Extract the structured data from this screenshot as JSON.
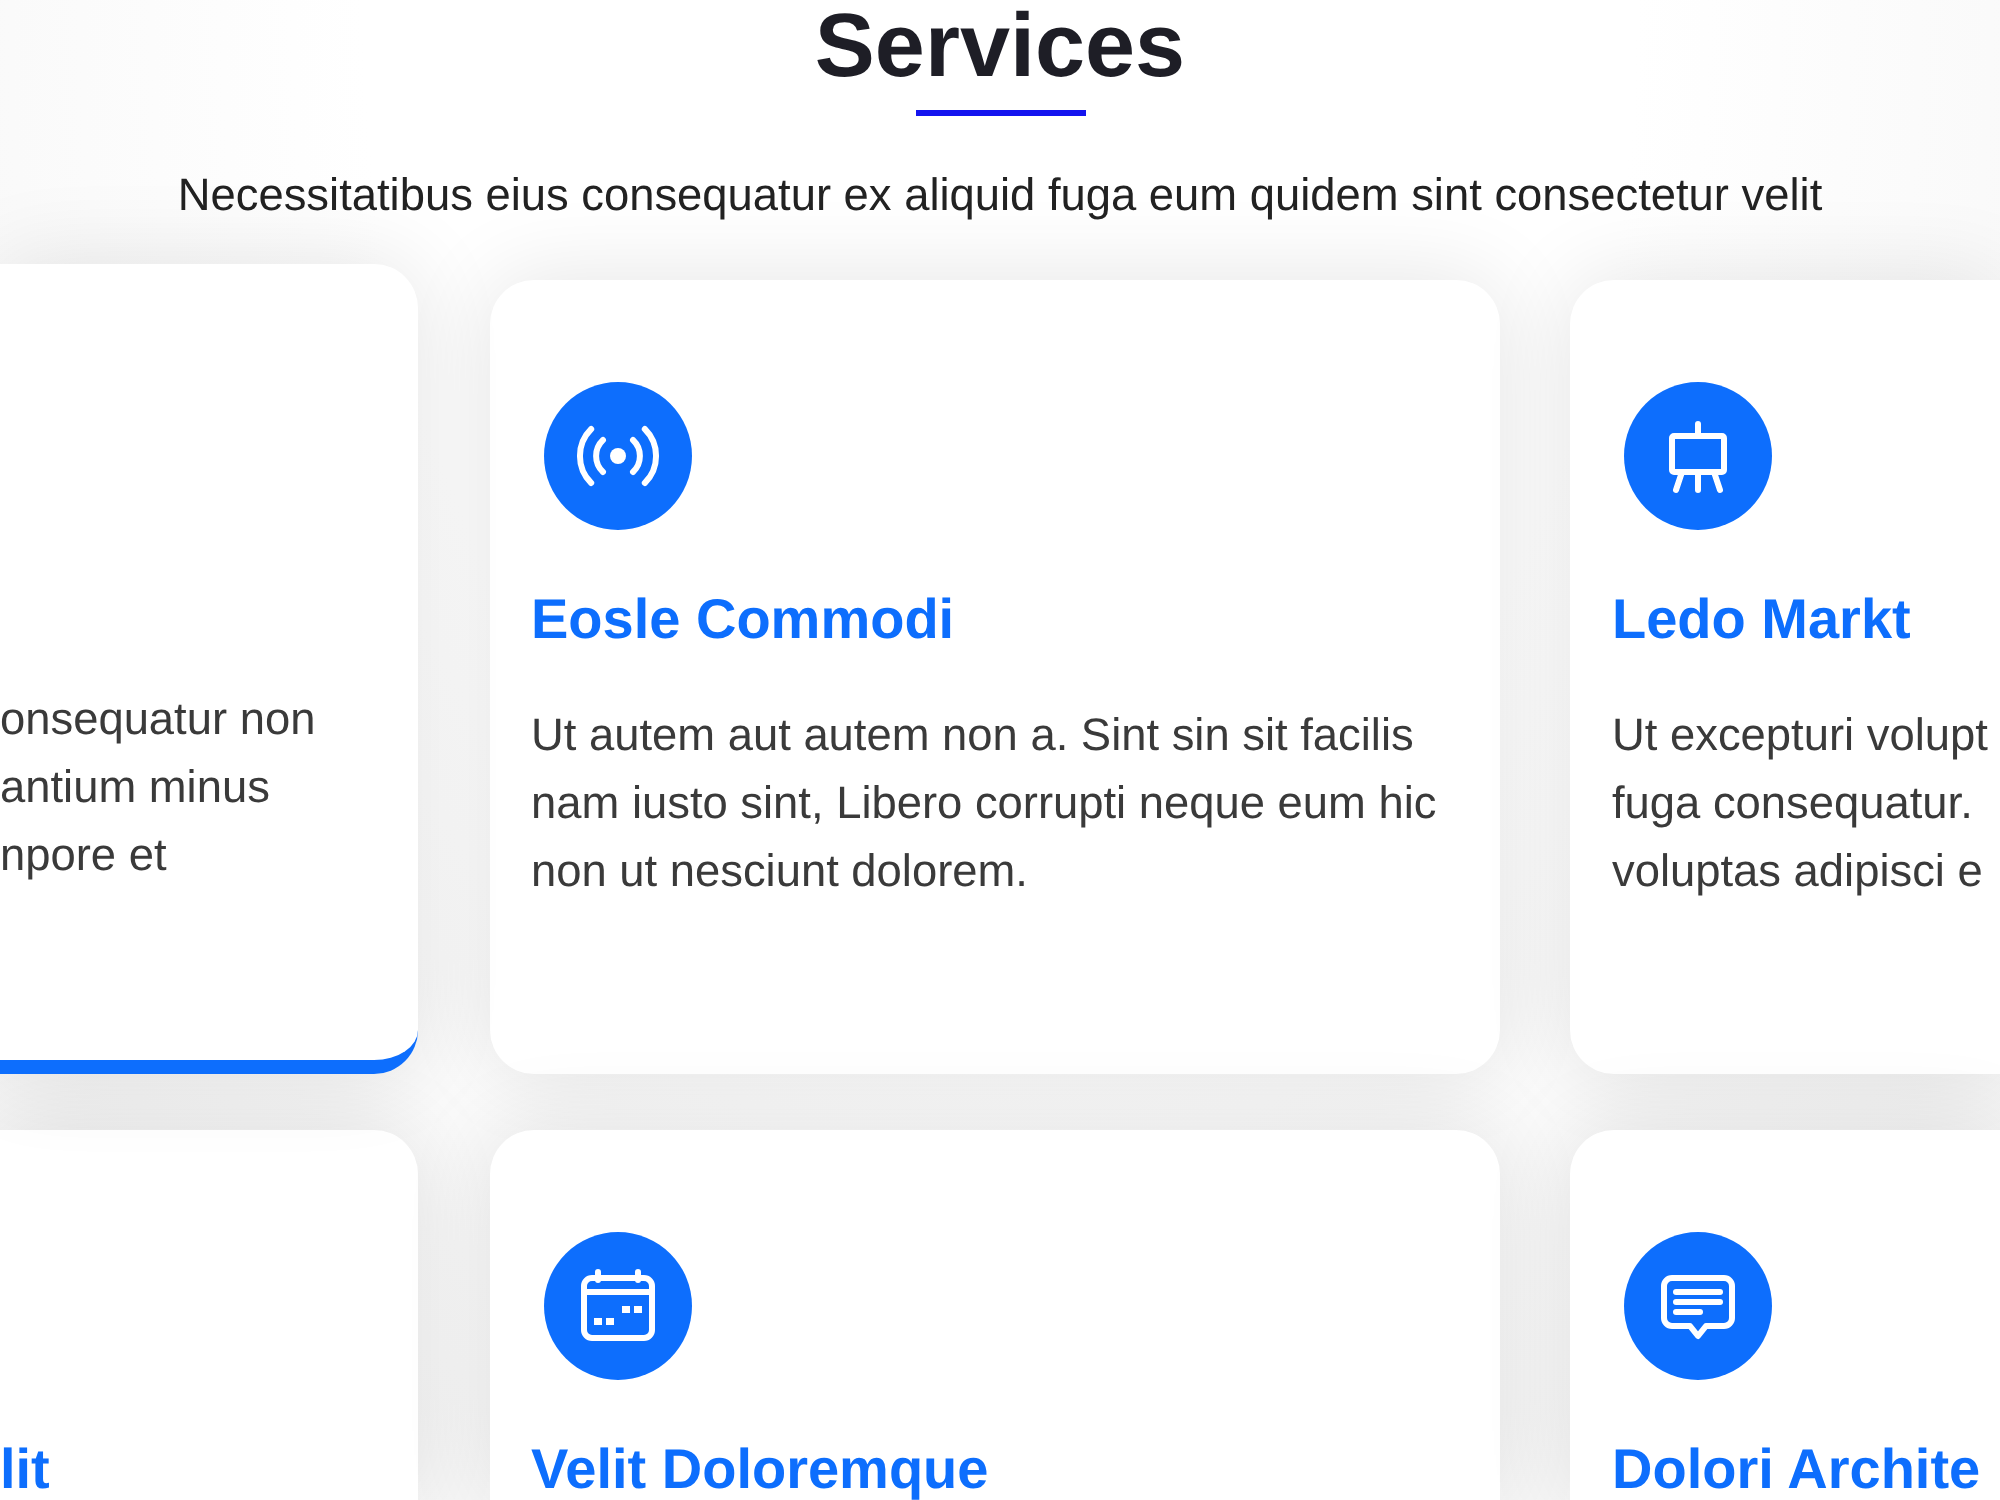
{
  "heading": {
    "title": "Services",
    "subtitle": "Necessitatibus eius consequatur ex aliquid fuga eum quidem sint consectetur velit"
  },
  "service_rows": [
    {
      "cards": [
        {
          "kind": "cut_left",
          "hovered": true,
          "description": "onsequatur non\nantium minus\nnpore et"
        },
        {
          "kind": "full",
          "hovered": false,
          "title": "Eosle Commodi",
          "description": "Ut autem aut autem non a. Sint sin sit facilis nam iusto sint, Libero corrupti neque eum hic non ut nesciunt dolorem."
        },
        {
          "kind": "cut_right",
          "hovered": false,
          "title": "Ledo Markt",
          "description": "Ut excepturi volupt\nfuga consequatur.\nvoluptas adipisci e"
        }
      ]
    },
    {
      "cards": [
        {
          "kind": "cut_left",
          "hovered": false,
          "title": "lit"
        },
        {
          "kind": "full",
          "hovered": false,
          "title": "Velit Doloremque"
        },
        {
          "kind": "cut_right",
          "hovered": false,
          "title": "Dolori Archite"
        }
      ]
    }
  ]
}
